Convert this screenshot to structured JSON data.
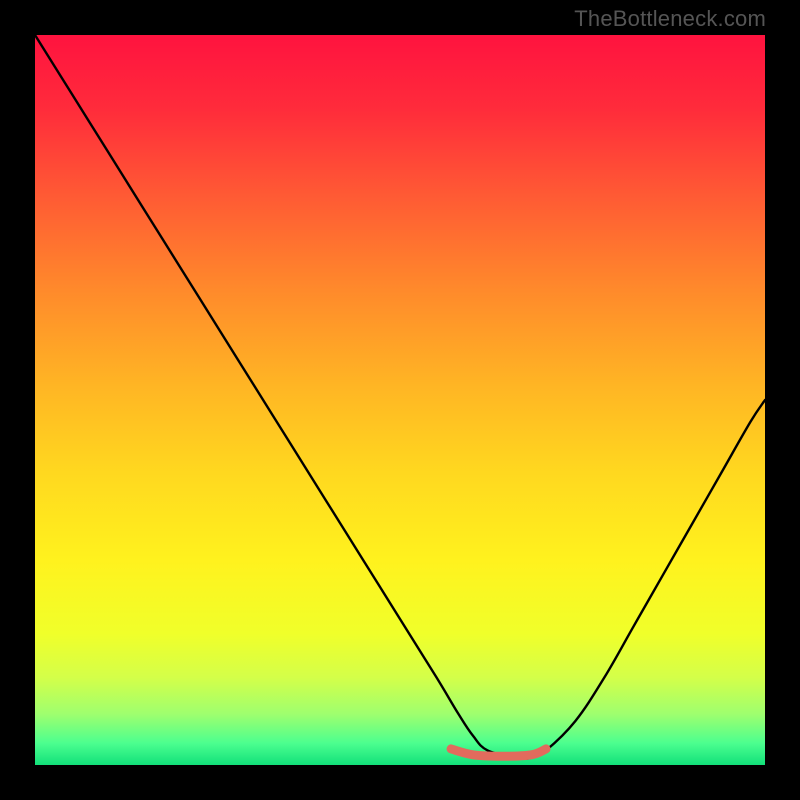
{
  "watermark": "TheBottleneck.com",
  "chart_data": {
    "type": "line",
    "title": "",
    "xlabel": "",
    "ylabel": "",
    "xlim": [
      0,
      100
    ],
    "ylim": [
      0,
      100
    ],
    "grid": false,
    "legend": false,
    "annotations": [],
    "gradient_stops": [
      {
        "offset": 0.0,
        "color": "#ff133f"
      },
      {
        "offset": 0.1,
        "color": "#ff2b3b"
      },
      {
        "offset": 0.22,
        "color": "#ff5a34"
      },
      {
        "offset": 0.35,
        "color": "#ff8a2b"
      },
      {
        "offset": 0.48,
        "color": "#ffb524"
      },
      {
        "offset": 0.6,
        "color": "#ffd81f"
      },
      {
        "offset": 0.72,
        "color": "#fff21e"
      },
      {
        "offset": 0.82,
        "color": "#f0ff2a"
      },
      {
        "offset": 0.88,
        "color": "#d4ff49"
      },
      {
        "offset": 0.93,
        "color": "#9fff6e"
      },
      {
        "offset": 0.97,
        "color": "#4cff8f"
      },
      {
        "offset": 1.0,
        "color": "#12e07a"
      }
    ],
    "series": [
      {
        "name": "bottleneck-curve",
        "color": "#000000",
        "width": 2.4,
        "x": [
          0,
          5,
          10,
          15,
          20,
          25,
          30,
          35,
          40,
          45,
          50,
          55,
          58,
          60,
          62,
          66,
          68,
          70,
          74,
          78,
          82,
          86,
          90,
          94,
          98,
          100
        ],
        "y": [
          100,
          92,
          84,
          76,
          68,
          60,
          52,
          44,
          36,
          28,
          20,
          12,
          7,
          4,
          2,
          1,
          1,
          2,
          6,
          12,
          19,
          26,
          33,
          40,
          47,
          50
        ]
      },
      {
        "name": "highlight-band",
        "color": "#e26b5d",
        "width": 9,
        "x": [
          57,
          60,
          64,
          68,
          70
        ],
        "y": [
          2.2,
          1.4,
          1.2,
          1.4,
          2.2
        ]
      }
    ]
  }
}
